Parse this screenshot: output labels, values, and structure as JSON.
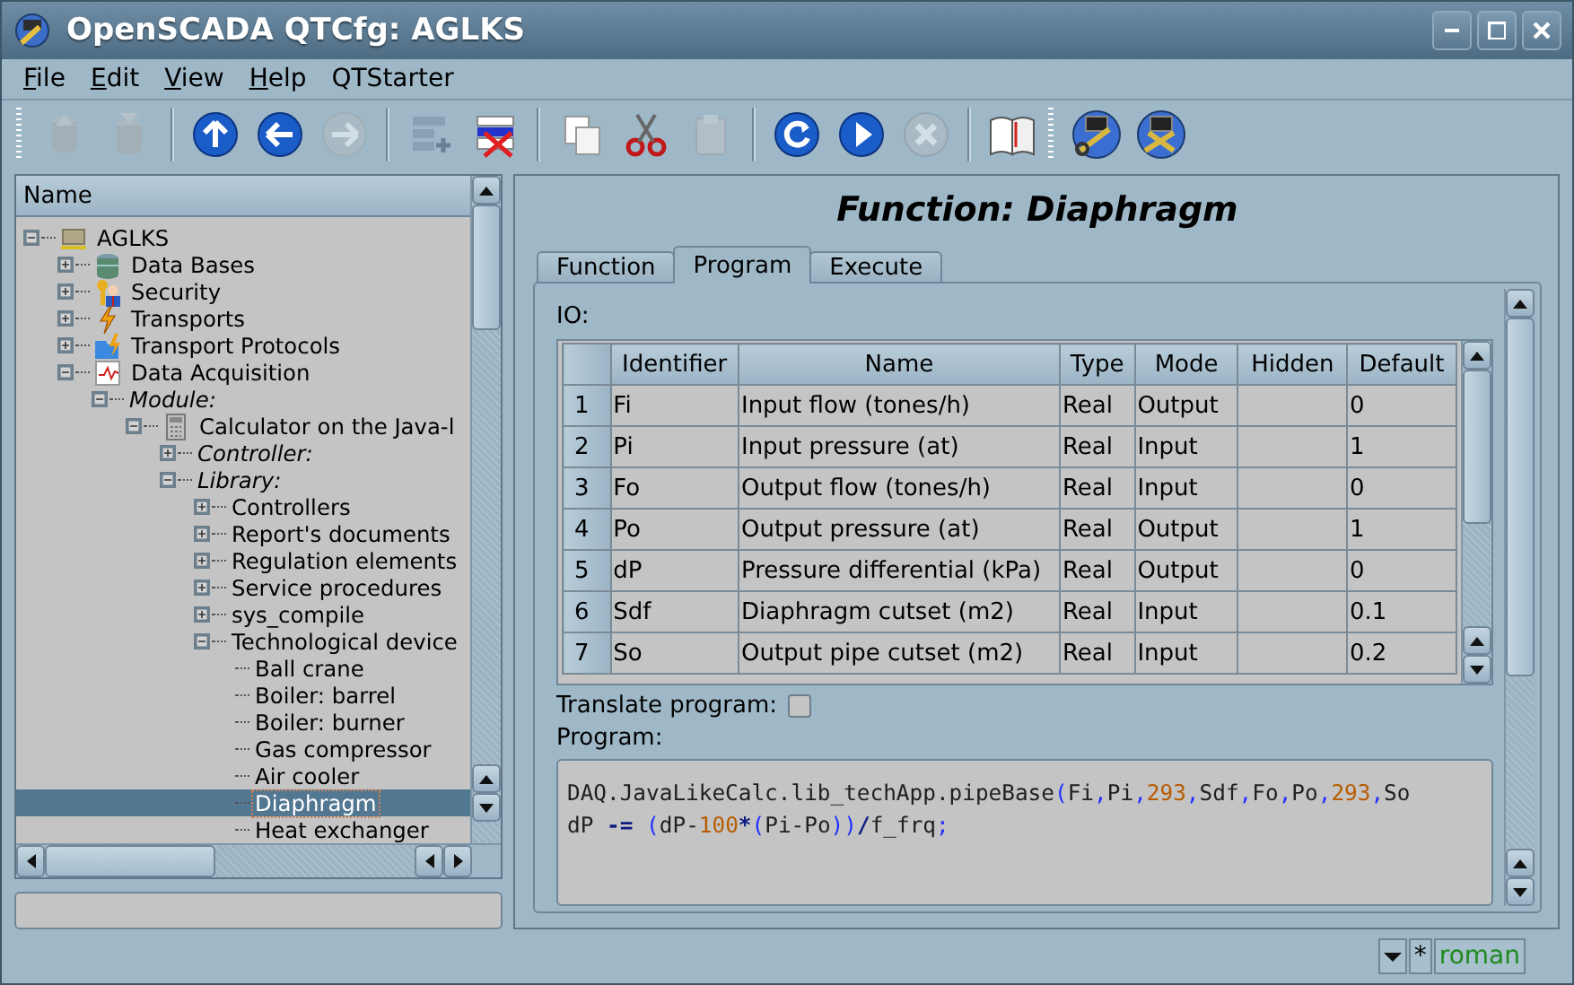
{
  "window": {
    "title": "OpenSCADA QTCfg: AGLKS"
  },
  "menu": [
    {
      "label": "File",
      "underline_first": true
    },
    {
      "label": "Edit",
      "underline_first": true
    },
    {
      "label": "View",
      "underline_first": true
    },
    {
      "label": "Help",
      "underline_first": true
    },
    {
      "label": "QTStarter",
      "underline_first": false
    }
  ],
  "toolbar": [
    [
      {
        "disabled": true
      },
      {
        "disabled": true
      }
    ],
    [
      {
        "disabled": false
      },
      {
        "disabled": false
      },
      {
        "disabled": true
      }
    ],
    [
      {
        "disabled": false
      },
      {
        "disabled": false
      }
    ],
    [
      {
        "disabled": false
      },
      {
        "disabled": false
      },
      {
        "disabled": true
      }
    ],
    [
      {
        "disabled": false
      },
      {
        "disabled": false
      },
      {
        "disabled": true
      }
    ],
    [
      {
        "disabled": false
      }
    ],
    [
      {
        "disabled": false
      },
      {
        "disabled": false
      }
    ]
  ],
  "tree": {
    "header": "Name",
    "nodes": [
      {
        "label": "AGLKS",
        "kind": "station",
        "expanded": true,
        "selected": false,
        "children": [
          {
            "label": "Data Bases",
            "kind": "subsystem",
            "expanded": false,
            "selected": false
          },
          {
            "label": "Security",
            "kind": "subsystem",
            "expanded": false,
            "selected": false
          },
          {
            "label": "Transports",
            "kind": "subsystem",
            "expanded": false,
            "selected": false
          },
          {
            "label": "Transport Protocols",
            "kind": "subsystem",
            "expanded": false,
            "selected": false
          },
          {
            "label": "Data Acquisition",
            "kind": "subsystem",
            "expanded": true,
            "selected": false,
            "children": [
              {
                "label": "Module:",
                "kind": "group",
                "expanded": true,
                "selected": false,
                "children": [
                  {
                    "label": "Calculator on the Java-l",
                    "kind": "module",
                    "expanded": true,
                    "selected": false,
                    "children": [
                      {
                        "label": "Controller:",
                        "kind": "group",
                        "expanded": false,
                        "selected": false
                      },
                      {
                        "label": "Library:",
                        "kind": "group",
                        "expanded": true,
                        "selected": false,
                        "children": [
                          {
                            "label": "Controllers",
                            "kind": "item",
                            "expanded": false,
                            "selected": false
                          },
                          {
                            "label": "Report's documents",
                            "kind": "item",
                            "expanded": false,
                            "selected": false
                          },
                          {
                            "label": "Regulation elements",
                            "kind": "item",
                            "expanded": false,
                            "selected": false
                          },
                          {
                            "label": "Service procedures",
                            "kind": "item",
                            "expanded": false,
                            "selected": false
                          },
                          {
                            "label": "sys_compile",
                            "kind": "item",
                            "expanded": false,
                            "selected": false
                          },
                          {
                            "label": "Technological device",
                            "kind": "item",
                            "expanded": true,
                            "selected": false,
                            "children": [
                              {
                                "label": "Ball crane",
                                "kind": "item",
                                "selected": false
                              },
                              {
                                "label": "Boiler: barrel",
                                "kind": "item",
                                "selected": false
                              },
                              {
                                "label": "Boiler: burner",
                                "kind": "item",
                                "selected": false
                              },
                              {
                                "label": "Gas compressor",
                                "kind": "item",
                                "selected": false
                              },
                              {
                                "label": "Air cooler",
                                "kind": "item",
                                "selected": false
                              },
                              {
                                "label": "Diaphragm",
                                "kind": "item",
                                "selected": true
                              },
                              {
                                "label": "Heat exchanger",
                                "kind": "item",
                                "selected": false
                              }
                            ]
                          }
                        ]
                      }
                    ]
                  }
                ]
              }
            ]
          }
        ]
      }
    ]
  },
  "panel": {
    "title": "Function: Diaphragm",
    "tabs": [
      {
        "label": "Function",
        "selected": false
      },
      {
        "label": "Program",
        "selected": true
      },
      {
        "label": "Execute",
        "selected": false
      }
    ],
    "io_label": "IO:",
    "table": {
      "columns": [
        "Identifier",
        "Name",
        "Type",
        "Mode",
        "Hidden",
        "Default"
      ],
      "rows": [
        {
          "number": "1",
          "cells": [
            "Fi",
            "Input flow (tones/h)",
            "Real",
            "Output",
            "",
            "0"
          ]
        },
        {
          "number": "2",
          "cells": [
            "Pi",
            "Input pressure (at)",
            "Real",
            "Input",
            "",
            "1"
          ]
        },
        {
          "number": "3",
          "cells": [
            "Fo",
            "Output flow (tones/h)",
            "Real",
            "Input",
            "",
            "0"
          ]
        },
        {
          "number": "4",
          "cells": [
            "Po",
            "Output pressure (at)",
            "Real",
            "Output",
            "",
            "1"
          ]
        },
        {
          "number": "5",
          "cells": [
            "dP",
            "Pressure differential (kPa)",
            "Real",
            "Output",
            "",
            "0"
          ]
        },
        {
          "number": "6",
          "cells": [
            "Sdf",
            "Diaphragm cutset (m2)",
            "Real",
            "Input",
            "",
            "0.1"
          ]
        },
        {
          "number": "7",
          "cells": [
            "So",
            "Output pipe cutset (m2)",
            "Real",
            "Input",
            "",
            "0.2"
          ]
        }
      ]
    },
    "translate": {
      "label": "Translate program:",
      "checked": false
    },
    "program_label": "Program:",
    "program": [
      {
        "tokens": [
          {
            "text": "DAQ.JavaLikeCalc.lib_techApp.pipeBase",
            "kind": "plain"
          },
          {
            "text": "(",
            "kind": "symbol"
          },
          {
            "text": "Fi",
            "kind": "plain"
          },
          {
            "text": ",",
            "kind": "symbol"
          },
          {
            "text": "Pi",
            "kind": "plain"
          },
          {
            "text": ",",
            "kind": "symbol"
          },
          {
            "text": "293",
            "kind": "number"
          },
          {
            "text": ",",
            "kind": "symbol"
          },
          {
            "text": "Sdf",
            "kind": "plain"
          },
          {
            "text": ",",
            "kind": "symbol"
          },
          {
            "text": "Fo",
            "kind": "plain"
          },
          {
            "text": ",",
            "kind": "symbol"
          },
          {
            "text": "Po",
            "kind": "plain"
          },
          {
            "text": ",",
            "kind": "symbol"
          },
          {
            "text": "293",
            "kind": "number"
          },
          {
            "text": ",",
            "kind": "symbol"
          },
          {
            "text": "So",
            "kind": "plain"
          }
        ]
      },
      {
        "tokens": [
          {
            "text": "dP ",
            "kind": "plain"
          },
          {
            "text": "-=",
            "kind": "operator"
          },
          {
            "text": " (",
            "kind": "symbol"
          },
          {
            "text": "dP-",
            "kind": "plain"
          },
          {
            "text": "100",
            "kind": "number"
          },
          {
            "text": "*",
            "kind": "operator"
          },
          {
            "text": "(",
            "kind": "symbol"
          },
          {
            "text": "Pi-Po",
            "kind": "plain"
          },
          {
            "text": "))",
            "kind": "symbol"
          },
          {
            "text": "/",
            "kind": "operator"
          },
          {
            "text": "f_frq",
            "kind": "plain"
          },
          {
            "text": ";",
            "kind": "symbol"
          }
        ]
      }
    ]
  },
  "status_bar": {
    "mark": "*",
    "user": "roman"
  }
}
